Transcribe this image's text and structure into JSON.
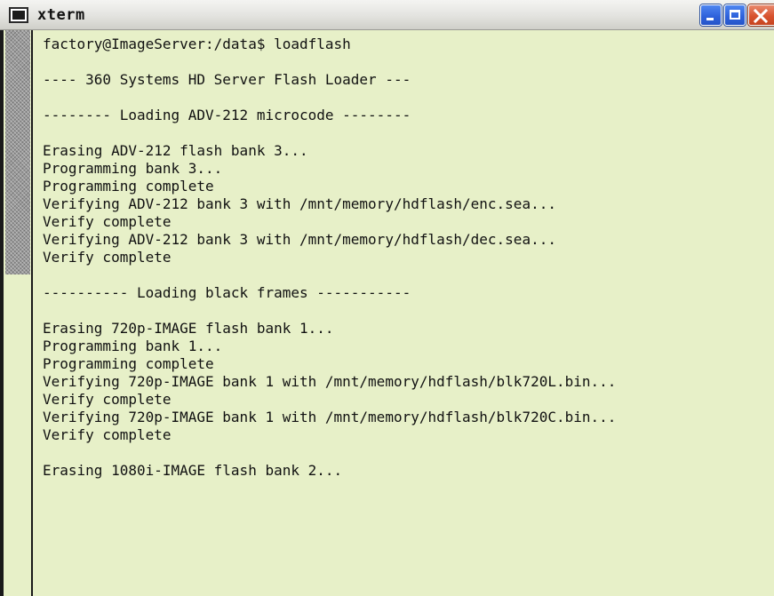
{
  "window": {
    "title": "xterm",
    "colors": {
      "terminal_bg": "#e7f0c8",
      "terminal_fg": "#111111",
      "close_button": "#d8532f",
      "titlebar_button": "#2f63dc"
    },
    "icons": {
      "app": "terminal-icon",
      "minimize": "minimize-icon",
      "maximize": "maximize-icon",
      "close": "close-icon"
    }
  },
  "terminal": {
    "lines": [
      "factory@ImageServer:/data$ loadflash",
      "",
      "---- 360 Systems HD Server Flash Loader ---",
      "",
      "-------- Loading ADV-212 microcode --------",
      "",
      "Erasing ADV-212 flash bank 3...",
      "Programming bank 3...",
      "Programming complete",
      "Verifying ADV-212 bank 3 with /mnt/memory/hdflash/enc.sea...",
      "Verify complete",
      "Verifying ADV-212 bank 3 with /mnt/memory/hdflash/dec.sea...",
      "Verify complete",
      "",
      "---------- Loading black frames -----------",
      "",
      "Erasing 720p-IMAGE flash bank 1...",
      "Programming bank 1...",
      "Programming complete",
      "Verifying 720p-IMAGE bank 1 with /mnt/memory/hdflash/blk720L.bin...",
      "Verify complete",
      "Verifying 720p-IMAGE bank 1 with /mnt/memory/hdflash/blk720C.bin...",
      "Verify complete",
      "",
      "Erasing 1080i-IMAGE flash bank 2..."
    ]
  }
}
